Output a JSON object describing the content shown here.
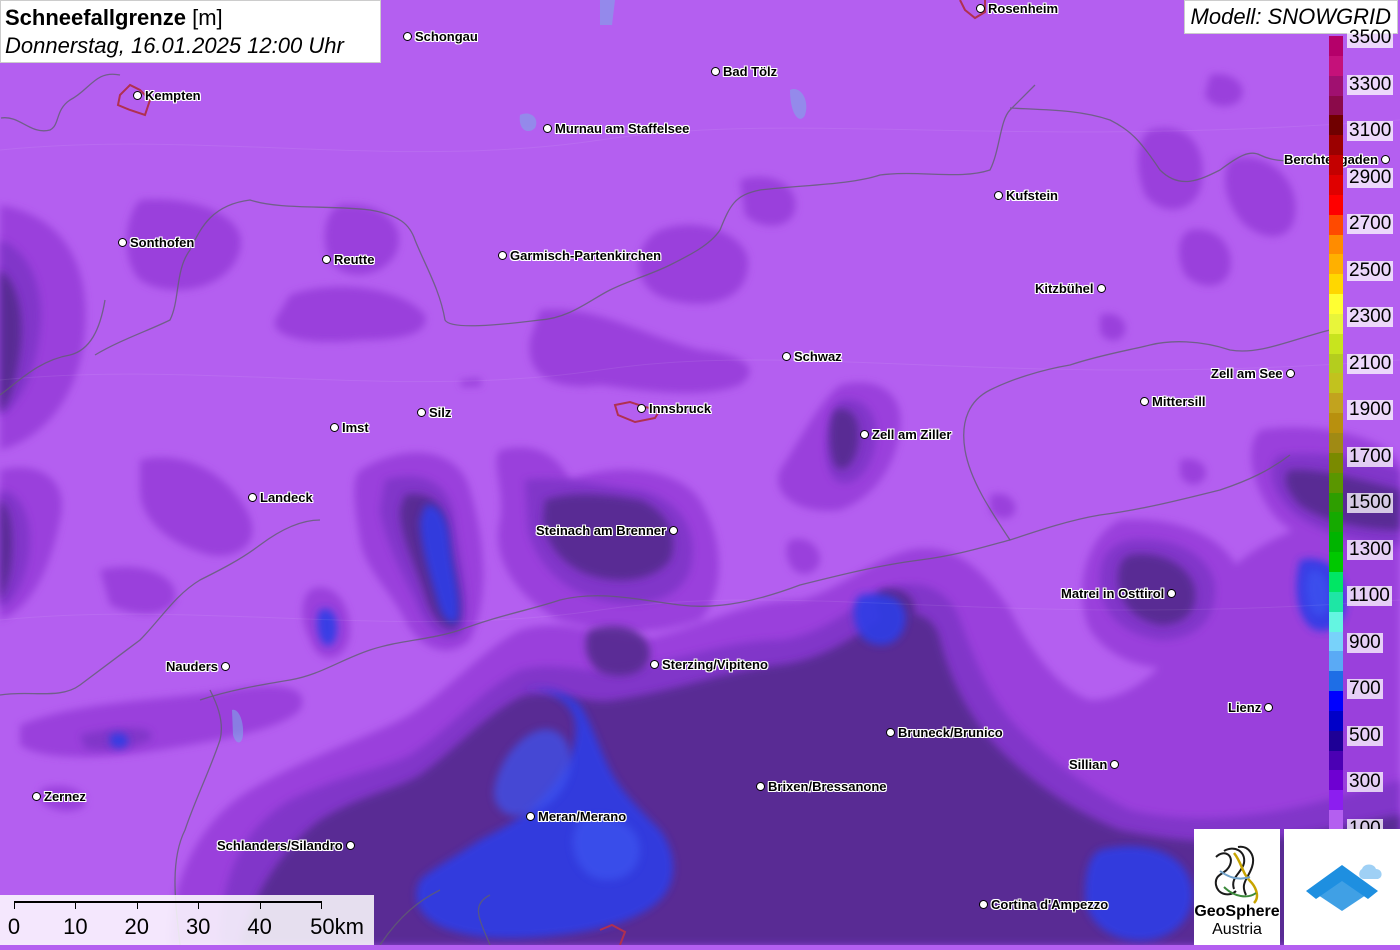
{
  "title": {
    "main": "Schneefallgrenze",
    "unit": "[m]",
    "datetime": "Donnerstag, 16.01.2025 12:00 Uhr"
  },
  "model": "Modell: SNOWGRID",
  "cities": [
    {
      "name": "Rosenheim",
      "side": "right"
    },
    {
      "name": "Schongau",
      "side": "right"
    },
    {
      "name": "Kempten",
      "side": "right"
    },
    {
      "name": "Bad Tölz",
      "side": "right"
    },
    {
      "name": "Murnau am Staffelsee",
      "side": "right"
    },
    {
      "name": "Berchtesgaden",
      "side": "left"
    },
    {
      "name": "Kufstein",
      "side": "right"
    },
    {
      "name": "Sonthofen",
      "side": "right"
    },
    {
      "name": "Reutte",
      "side": "right"
    },
    {
      "name": "Garmisch-Partenkirchen",
      "side": "right"
    },
    {
      "name": "Kitzbühel",
      "side": "left"
    },
    {
      "name": "Schwaz",
      "side": "right"
    },
    {
      "name": "Zell am See",
      "side": "left"
    },
    {
      "name": "Innsbruck",
      "side": "right"
    },
    {
      "name": "Silz",
      "side": "right"
    },
    {
      "name": "Imst",
      "side": "right"
    },
    {
      "name": "Mittersill",
      "side": "right"
    },
    {
      "name": "Zell am Ziller",
      "side": "right"
    },
    {
      "name": "Landeck",
      "side": "right"
    },
    {
      "name": "Steinach am Brenner",
      "side": "left"
    },
    {
      "name": "Matrei in Osttirol",
      "side": "left"
    },
    {
      "name": "Nauders",
      "side": "left"
    },
    {
      "name": "Sterzing/Vipiteno",
      "side": "right"
    },
    {
      "name": "Lienz",
      "side": "left"
    },
    {
      "name": "Bruneck/Brunico",
      "side": "right"
    },
    {
      "name": "Sillian",
      "side": "left"
    },
    {
      "name": "Brixen/Bressanone",
      "side": "right"
    },
    {
      "name": "Zernez",
      "side": "right"
    },
    {
      "name": "Meran/Merano",
      "side": "right"
    },
    {
      "name": "Schlanders/Silandro",
      "side": "left"
    },
    {
      "name": "Cortina d'Ampezzo",
      "side": "right"
    }
  ],
  "legend": {
    "labels": [
      "3500",
      "3300",
      "3100",
      "2900",
      "2700",
      "2500",
      "2300",
      "2100",
      "1900",
      "1700",
      "1500",
      "1300",
      "1100",
      "900",
      "700",
      "500",
      "300",
      "100"
    ],
    "colors": [
      "#b5006a",
      "#c5117a",
      "#a01070",
      "#8b0a4a",
      "#700000",
      "#9c0000",
      "#c40000",
      "#e00000",
      "#ff0000",
      "#ff4a00",
      "#ff8c00",
      "#ffb000",
      "#ffd700",
      "#ffff33",
      "#e8f53a",
      "#c8e41e",
      "#b4cd1e",
      "#c2c21e",
      "#c2a31e",
      "#b8900e",
      "#a08a14",
      "#7a8a00",
      "#5a9600",
      "#2e9e00",
      "#15aa00",
      "#00b400",
      "#00c800",
      "#00e664",
      "#1ee6a5",
      "#64f5e1",
      "#78d2fa",
      "#5aaaf5",
      "#1e6ee6",
      "#0000ff",
      "#0000c8",
      "#1e0096",
      "#4b00b4",
      "#6e00d2",
      "#8c1ef0",
      "#b45ff0"
    ]
  },
  "scale_bar": {
    "ticks": [
      "0",
      "10",
      "20",
      "30",
      "40",
      "50km"
    ]
  },
  "logos": {
    "geosphere": "GeoSphere",
    "geosphere_sub": "Austria"
  },
  "colors": {
    "background": "#b45ff0",
    "mid": "#8d3fd6",
    "dark": "#4f2a8e",
    "blue": "#2f3ee6"
  }
}
